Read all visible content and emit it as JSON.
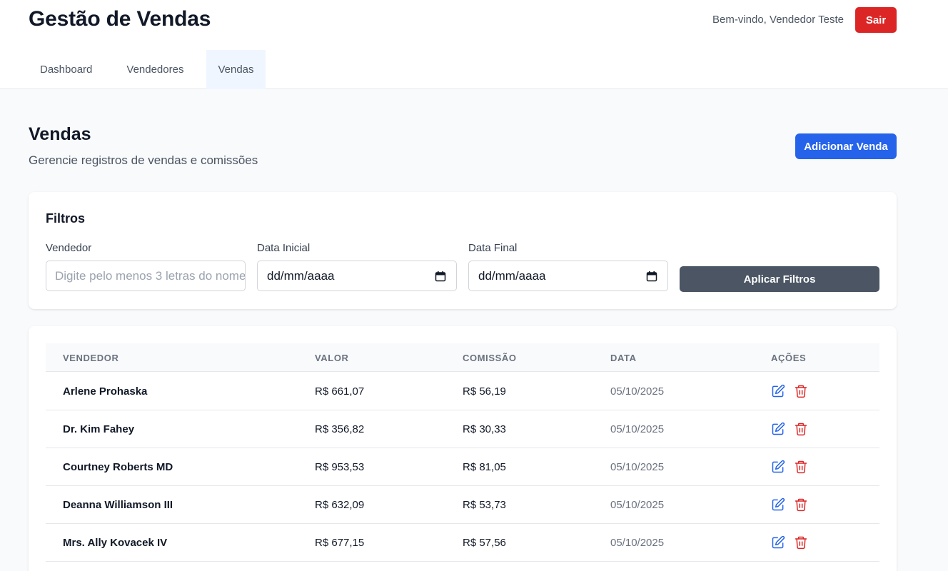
{
  "header": {
    "title": "Gestão de Vendas",
    "welcome": "Bem-vindo, Vendedor Teste",
    "logout_label": "Sair"
  },
  "nav": {
    "tabs": [
      {
        "label": "Dashboard",
        "active": false
      },
      {
        "label": "Vendedores",
        "active": false
      },
      {
        "label": "Vendas",
        "active": true
      }
    ]
  },
  "page": {
    "title": "Vendas",
    "subtitle": "Gerencie registros de vendas e comissões",
    "add_label": "Adicionar Venda"
  },
  "filters": {
    "title": "Filtros",
    "vendedor_label": "Vendedor",
    "vendedor_placeholder": "Digite pelo menos 3 letras do nome",
    "data_inicial_label": "Data Inicial",
    "data_inicial_value": "dd/mm/aaaa",
    "data_final_label": "Data Final",
    "data_final_value": "dd/mm/aaaa",
    "apply_label": "Aplicar Filtros"
  },
  "table": {
    "columns": [
      "VENDEDOR",
      "VALOR",
      "COMISSÃO",
      "DATA",
      "AÇÕES"
    ],
    "rows": [
      {
        "vendedor": "Arlene Prohaska",
        "valor": "R$ 661,07",
        "comissao": "R$ 56,19",
        "data": "05/10/2025"
      },
      {
        "vendedor": "Dr. Kim Fahey",
        "valor": "R$ 356,82",
        "comissao": "R$ 30,33",
        "data": "05/10/2025"
      },
      {
        "vendedor": "Courtney Roberts MD",
        "valor": "R$ 953,53",
        "comissao": "R$ 81,05",
        "data": "05/10/2025"
      },
      {
        "vendedor": "Deanna Williamson III",
        "valor": "R$ 632,09",
        "comissao": "R$ 53,73",
        "data": "05/10/2025"
      },
      {
        "vendedor": "Mrs. Ally Kovacek IV",
        "valor": "R$ 677,15",
        "comissao": "R$ 57,56",
        "data": "05/10/2025"
      }
    ],
    "row_actions": [
      "edit-icon",
      "trash-icon"
    ]
  },
  "colors": {
    "primary": "#2563eb",
    "danger": "#dc2626",
    "neutral_button": "#4b5563",
    "active_tab_bg": "#eff6ff"
  }
}
